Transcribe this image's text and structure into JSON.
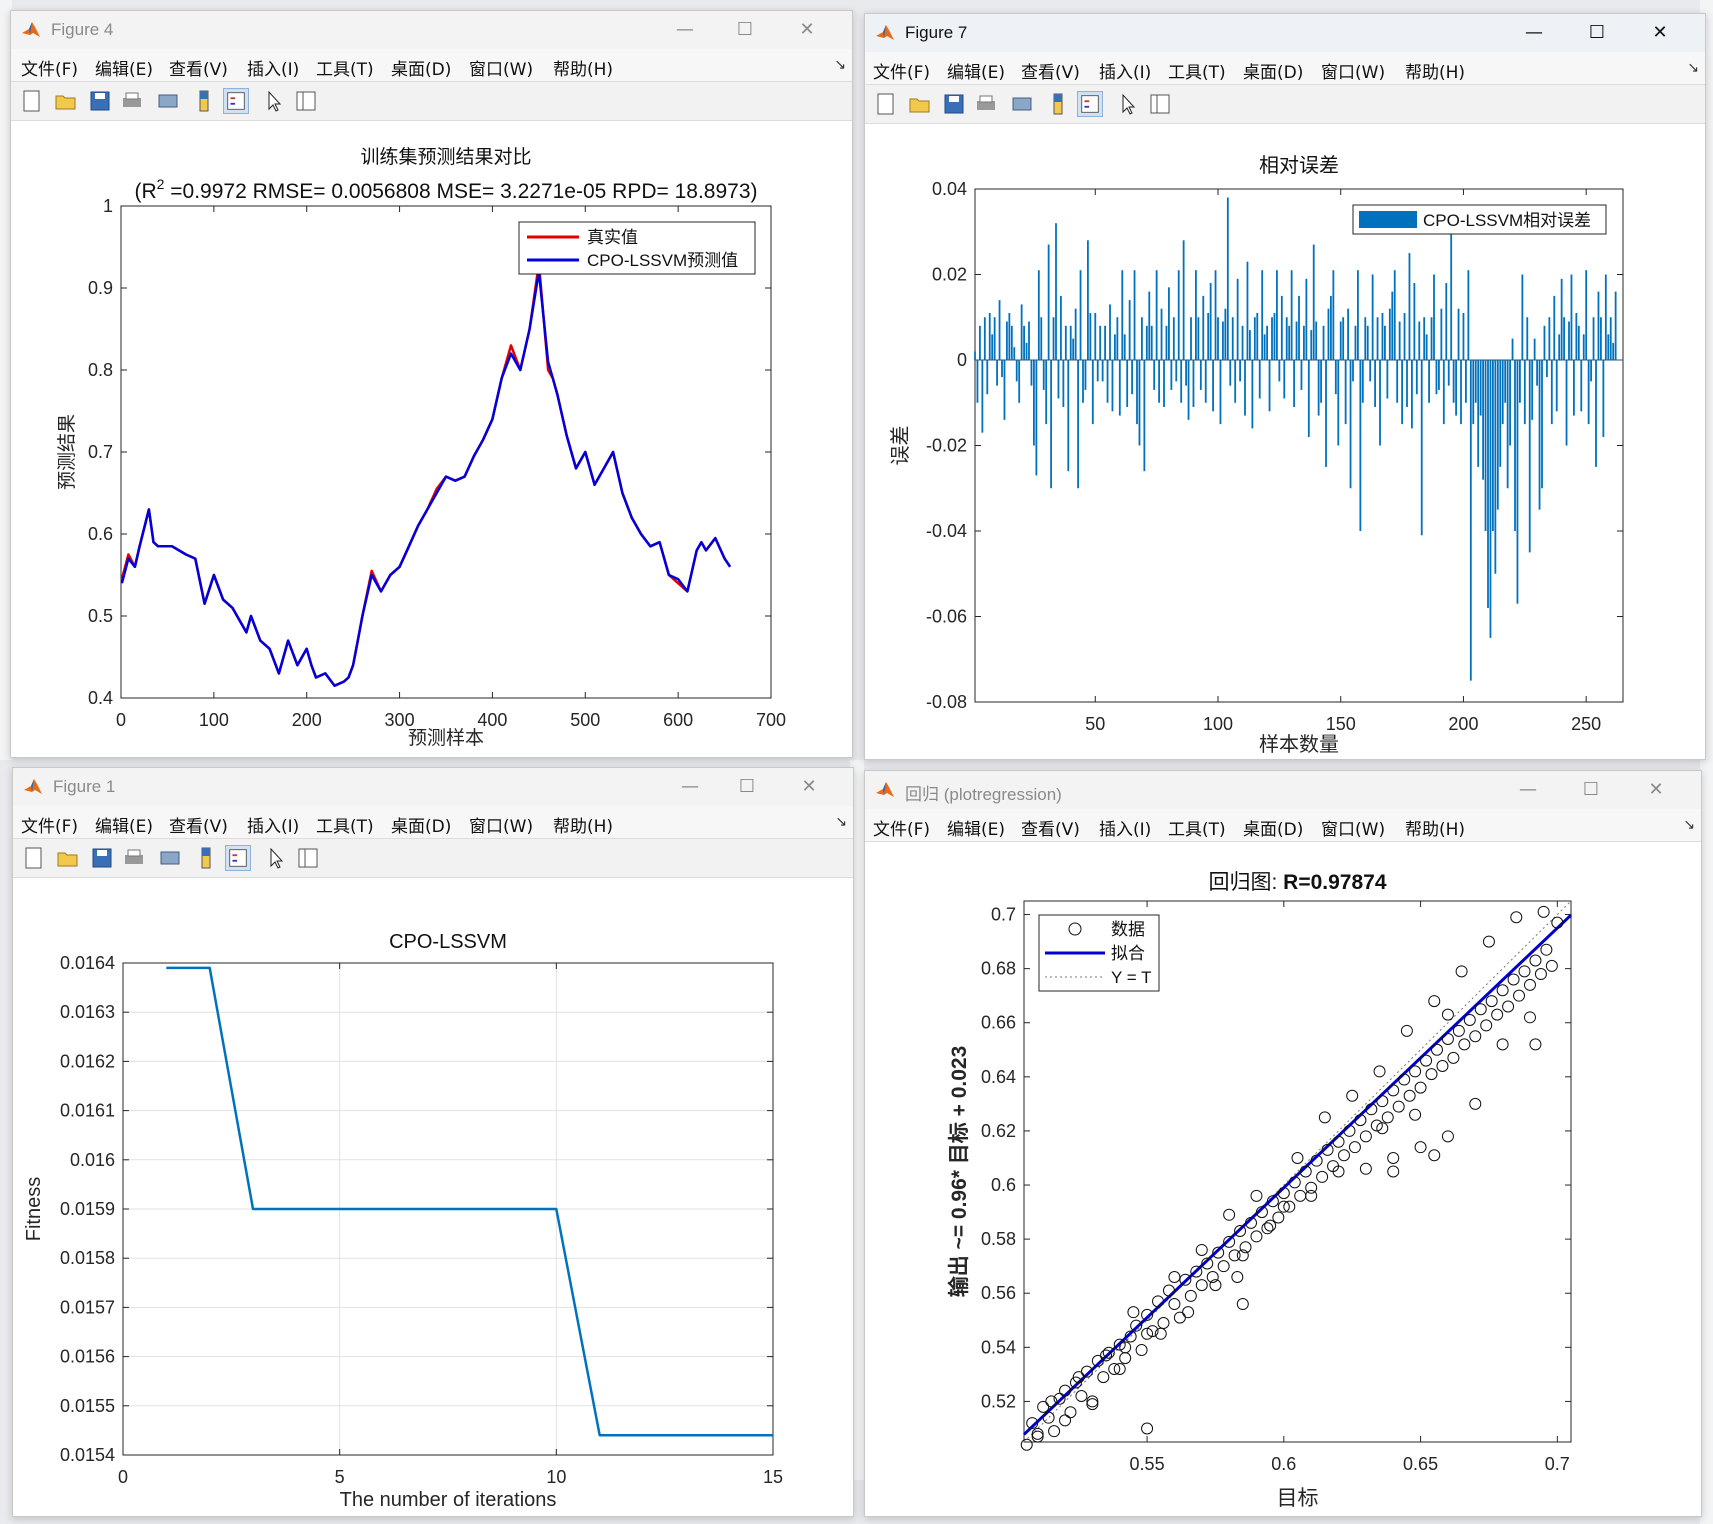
{
  "windows": {
    "fig4": {
      "title": "Figure 4"
    },
    "fig7": {
      "title": "Figure 7"
    },
    "fig1": {
      "title": "Figure 1"
    },
    "reg": {
      "title": "回归 (plotregression)"
    }
  },
  "menu": [
    "文件(F)",
    "编辑(E)",
    "查看(V)",
    "插入(I)",
    "工具(T)",
    "桌面(D)",
    "窗口(W)",
    "帮助(H)"
  ],
  "window_buttons": {
    "minimize": "—",
    "maximize": "☐",
    "close": "✕"
  },
  "toolbar_icons": [
    "new-figure-icon",
    "open-file-icon",
    "save-icon",
    "print-icon",
    "print-preview-icon",
    "colorbar-icon",
    "legend-icon",
    "edit-plot-icon",
    "property-inspector-icon"
  ],
  "colors": {
    "red": "#e00000",
    "blue": "#0000dd",
    "matlab_blue": "#0072bd",
    "dark_blue": "#0000cc"
  },
  "fig4": {
    "chart_data": {
      "type": "line",
      "title": "训练集预测结果对比",
      "subtitle_parts": [
        "(R",
        "2",
        " =0.9972 RMSE= 0.0056808 MSE= 3.2271e-05 RPD= 18.8973)"
      ],
      "xlabel": "预测样本",
      "ylabel": "预测结果",
      "xlim": [
        0,
        700
      ],
      "ylim": [
        0.4,
        1.0
      ],
      "xticks": [
        "0",
        "100",
        "200",
        "300",
        "400",
        "500",
        "600",
        "700"
      ],
      "yticks": [
        "0.4",
        "0.5",
        "0.6",
        "0.7",
        "0.8",
        "0.9",
        "1"
      ],
      "legend": [
        "真实值",
        "CPO-LSSVM预测值"
      ],
      "legend_position": "top-right",
      "series": [
        {
          "name": "真实值",
          "color": "#e00000",
          "x": [
            1,
            8,
            15,
            20,
            30,
            35,
            40,
            55,
            70,
            80,
            90,
            100,
            110,
            120,
            135,
            140,
            150,
            160,
            170,
            175,
            180,
            190,
            200,
            205,
            210,
            220,
            230,
            240,
            245,
            250,
            255,
            260,
            270,
            280,
            290,
            300,
            310,
            320,
            330,
            340,
            350,
            360,
            370,
            380,
            390,
            400,
            410,
            420,
            430,
            440,
            450,
            460,
            465,
            470,
            480,
            490,
            500,
            510,
            520,
            530,
            540,
            550,
            560,
            570,
            580,
            590,
            600,
            610,
            620,
            625,
            630,
            640,
            650,
            656
          ],
          "y": [
            0.545,
            0.575,
            0.56,
            0.585,
            0.63,
            0.59,
            0.585,
            0.585,
            0.575,
            0.57,
            0.515,
            0.55,
            0.52,
            0.51,
            0.48,
            0.5,
            0.47,
            0.46,
            0.43,
            0.45,
            0.47,
            0.44,
            0.46,
            0.44,
            0.425,
            0.43,
            0.415,
            0.42,
            0.425,
            0.44,
            0.47,
            0.5,
            0.555,
            0.53,
            0.55,
            0.56,
            0.585,
            0.61,
            0.63,
            0.655,
            0.67,
            0.665,
            0.67,
            0.695,
            0.715,
            0.74,
            0.79,
            0.83,
            0.8,
            0.85,
            0.93,
            0.8,
            0.79,
            0.77,
            0.72,
            0.68,
            0.7,
            0.66,
            0.68,
            0.7,
            0.65,
            0.62,
            0.6,
            0.585,
            0.59,
            0.55,
            0.54,
            0.53,
            0.58,
            0.59,
            0.58,
            0.595,
            0.57,
            0.56
          ]
        },
        {
          "name": "CPO-LSSVM预测值",
          "color": "#0000dd",
          "x": [
            1,
            8,
            15,
            20,
            30,
            35,
            40,
            55,
            70,
            80,
            90,
            100,
            110,
            120,
            135,
            140,
            150,
            160,
            170,
            175,
            180,
            190,
            200,
            205,
            210,
            220,
            230,
            240,
            245,
            250,
            255,
            260,
            270,
            280,
            290,
            300,
            310,
            320,
            330,
            340,
            350,
            360,
            370,
            380,
            390,
            400,
            410,
            420,
            430,
            440,
            450,
            460,
            465,
            470,
            480,
            490,
            500,
            510,
            520,
            530,
            540,
            550,
            560,
            570,
            580,
            590,
            600,
            610,
            620,
            625,
            630,
            640,
            650,
            656
          ],
          "y": [
            0.54,
            0.57,
            0.56,
            0.585,
            0.63,
            0.59,
            0.585,
            0.585,
            0.575,
            0.57,
            0.515,
            0.55,
            0.52,
            0.51,
            0.48,
            0.5,
            0.47,
            0.46,
            0.43,
            0.45,
            0.47,
            0.44,
            0.46,
            0.44,
            0.425,
            0.43,
            0.415,
            0.42,
            0.425,
            0.44,
            0.47,
            0.5,
            0.55,
            0.53,
            0.55,
            0.56,
            0.585,
            0.61,
            0.63,
            0.65,
            0.67,
            0.665,
            0.67,
            0.695,
            0.715,
            0.74,
            0.79,
            0.82,
            0.8,
            0.85,
            0.92,
            0.81,
            0.79,
            0.77,
            0.72,
            0.68,
            0.7,
            0.66,
            0.68,
            0.7,
            0.65,
            0.62,
            0.6,
            0.585,
            0.59,
            0.55,
            0.545,
            0.53,
            0.58,
            0.59,
            0.58,
            0.595,
            0.57,
            0.56
          ]
        }
      ]
    }
  },
  "fig7": {
    "chart_data": {
      "type": "bar",
      "title": "相对误差",
      "xlabel": "样本数量",
      "ylabel": "误差",
      "xlim": [
        1,
        265
      ],
      "ylim": [
        -0.08,
        0.04
      ],
      "xticks": [
        "50",
        "100",
        "150",
        "200",
        "250"
      ],
      "yticks": [
        "0.04",
        "0.02",
        "0",
        "-0.02",
        "-0.04",
        "-0.06",
        "-0.08"
      ],
      "legend": [
        "CPO-LSSVM相对误差"
      ],
      "legend_position": "top-right",
      "series": [
        {
          "name": "CPO-LSSVM相对误差",
          "color": "#0072bd",
          "values": [
            0.002,
            -0.01,
            0.008,
            -0.017,
            0.01,
            -0.008,
            0.011,
            0.006,
            0.01,
            -0.006,
            0.014,
            -0.004,
            -0.014,
            0.009,
            0.011,
            0.008,
            0.003,
            -0.005,
            -0.01,
            0.013,
            0.008,
            0.004,
            0.009,
            -0.006,
            -0.02,
            -0.027,
            0.021,
            0.01,
            -0.007,
            -0.015,
            0.027,
            -0.03,
            0.01,
            0.032,
            -0.009,
            0.015,
            -0.011,
            0.008,
            -0.026,
            0.008,
            0.005,
            0.012,
            -0.03,
            0.021,
            -0.01,
            -0.007,
            0.028,
            0.011,
            -0.015,
            0.011,
            -0.005,
            0.008,
            -0.005,
            0.008,
            -0.01,
            0.013,
            -0.012,
            0.006,
            0.01,
            -0.013,
            0.021,
            0.006,
            -0.011,
            0.014,
            -0.008,
            0.021,
            -0.015,
            -0.02,
            0.01,
            -0.026,
            0.008,
            0.016,
            0.008,
            -0.007,
            0.021,
            -0.01,
            0.012,
            -0.011,
            0.008,
            0.017,
            -0.007,
            0.01,
            -0.005,
            0.021,
            -0.01,
            0.028,
            -0.006,
            -0.014,
            0.01,
            -0.011,
            0.021,
            0.01,
            -0.007,
            0.015,
            -0.01,
            0.011,
            0.018,
            -0.012,
            0.021,
            0.01,
            -0.015,
            0.009,
            0.012,
            0.038,
            -0.006,
            0.01,
            -0.01,
            0.019,
            -0.005,
            0.008,
            -0.013,
            0.023,
            0.007,
            -0.016,
            0.01,
            0.011,
            -0.009,
            0.021,
            0.006,
            0.008,
            -0.012,
            0.01,
            0.011,
            0.021,
            -0.005,
            0.015,
            -0.009,
            0.01,
            0.008,
            0.021,
            -0.011,
            0.009,
            0.015,
            -0.007,
            0.008,
            0.019,
            -0.018,
            0.007,
            0.027,
            0.009,
            -0.013,
            -0.01,
            0.008,
            -0.025,
            0.012,
            0.015,
            0.021,
            -0.008,
            -0.02,
            0.009,
            0.01,
            -0.015,
            0.012,
            -0.03,
            -0.005,
            0.008,
            0.021,
            -0.04,
            -0.01,
            0.01,
            0.008,
            -0.005,
            0.02,
            -0.011,
            0.01,
            -0.02,
            0.011,
            0.008,
            -0.009,
            0.012,
            0.016,
            0.021,
            -0.01,
            0.009,
            -0.015,
            0.011,
            -0.011,
            0.025,
            -0.016,
            0.018,
            -0.008,
            0.009,
            -0.041,
            0.01,
            0.006,
            -0.01,
            0.01,
            0.02,
            -0.008,
            -0.007,
            0.012,
            -0.015,
            0.018,
            -0.006,
            0.03,
            -0.01,
            -0.013,
            0.012,
            -0.015,
            0.011,
            -0.01,
            0.021,
            -0.075,
            -0.015,
            -0.01,
            -0.025,
            -0.013,
            -0.028,
            -0.04,
            -0.058,
            -0.065,
            -0.04,
            -0.05,
            -0.035,
            -0.025,
            -0.015,
            -0.01,
            -0.03,
            -0.02,
            0.005,
            -0.04,
            -0.057,
            -0.01,
            0.02,
            -0.015,
            0.01,
            -0.045,
            -0.014,
            0.005,
            -0.006,
            -0.035,
            -0.03,
            0.008,
            -0.004,
            0.01,
            -0.015,
            0.015,
            -0.012,
            0.006,
            0.019,
            0.01,
            -0.02,
            0.009,
            0.02,
            -0.013,
            0.011,
            0.008,
            -0.012,
            0.006,
            0.021,
            -0.015,
            -0.005,
            0.01,
            -0.025,
            0.016,
            0.01,
            -0.018,
            0.02,
            0.006,
            0.01,
            0.004,
            0.016
          ]
        }
      ]
    }
  },
  "fig1": {
    "chart_data": {
      "type": "line",
      "title": "CPO-LSSVM",
      "xlabel": "The number of iterations",
      "ylabel": "Fitness",
      "xlim": [
        0,
        15
      ],
      "ylim": [
        0.0154,
        0.0164
      ],
      "grid": true,
      "xticks": [
        "0",
        "5",
        "10",
        "15"
      ],
      "yticks": [
        "0.0164",
        "0.0163",
        "0.0162",
        "0.0161",
        "0.016",
        "0.0159",
        "0.0158",
        "0.0157",
        "0.0156",
        "0.0155",
        "0.0154"
      ],
      "series": [
        {
          "color": "#0072bd",
          "x": [
            1,
            2,
            3,
            4,
            5,
            6,
            7,
            8,
            9,
            10,
            11,
            12,
            13,
            14,
            15
          ],
          "y": [
            0.01639,
            0.01639,
            0.0159,
            0.0159,
            0.0159,
            0.0159,
            0.0159,
            0.0159,
            0.0159,
            0.0159,
            0.01544,
            0.01544,
            0.01544,
            0.01544,
            0.01544
          ]
        }
      ]
    }
  },
  "reg": {
    "chart_data": {
      "type": "scatter",
      "title_prefix": "回归图: ",
      "title_value": "R=0.97874",
      "xlabel": "目标",
      "ylabel": "输出 ~= 0.96* 目标 + 0.023",
      "xlim": [
        0.505,
        0.705
      ],
      "ylim": [
        0.505,
        0.705
      ],
      "xticks": [
        "0.55",
        "0.6",
        "0.65",
        "0.7"
      ],
      "yticks": [
        "0.7",
        "0.68",
        "0.66",
        "0.64",
        "0.62",
        "0.6",
        "0.58",
        "0.56",
        "0.54",
        "0.52"
      ],
      "legend": [
        "数据",
        "拟合",
        "Y = T"
      ],
      "legend_position": "top-left",
      "fit": {
        "slope": 0.96,
        "intercept": 0.023,
        "color": "#0000cc"
      },
      "points_x": [
        0.506,
        0.508,
        0.51,
        0.512,
        0.514,
        0.516,
        0.518,
        0.52,
        0.522,
        0.524,
        0.526,
        0.528,
        0.53,
        0.532,
        0.534,
        0.536,
        0.538,
        0.54,
        0.542,
        0.544,
        0.546,
        0.548,
        0.55,
        0.552,
        0.554,
        0.556,
        0.558,
        0.56,
        0.562,
        0.564,
        0.566,
        0.568,
        0.57,
        0.572,
        0.574,
        0.576,
        0.578,
        0.58,
        0.582,
        0.584,
        0.586,
        0.588,
        0.59,
        0.592,
        0.594,
        0.596,
        0.598,
        0.6,
        0.602,
        0.604,
        0.606,
        0.608,
        0.61,
        0.612,
        0.614,
        0.616,
        0.618,
        0.62,
        0.622,
        0.624,
        0.626,
        0.628,
        0.63,
        0.632,
        0.634,
        0.636,
        0.638,
        0.64,
        0.642,
        0.644,
        0.646,
        0.648,
        0.65,
        0.652,
        0.654,
        0.656,
        0.658,
        0.66,
        0.662,
        0.664,
        0.666,
        0.668,
        0.67,
        0.672,
        0.674,
        0.676,
        0.678,
        0.68,
        0.682,
        0.684,
        0.686,
        0.688,
        0.69,
        0.692,
        0.694,
        0.696,
        0.698,
        0.7,
        0.51,
        0.515,
        0.52,
        0.525,
        0.53,
        0.535,
        0.54,
        0.545,
        0.55,
        0.555,
        0.56,
        0.565,
        0.57,
        0.575,
        0.58,
        0.585,
        0.59,
        0.595,
        0.6,
        0.605,
        0.61,
        0.615,
        0.62,
        0.625,
        0.63,
        0.635,
        0.64,
        0.645,
        0.65,
        0.655,
        0.66,
        0.665,
        0.67,
        0.675,
        0.68,
        0.685,
        0.69,
        0.695,
        0.55,
        0.542,
        0.585,
        0.583,
        0.64,
        0.655,
        0.66,
        0.692,
        0.636,
        0.648
      ],
      "points_y": [
        0.504,
        0.512,
        0.507,
        0.518,
        0.514,
        0.509,
        0.521,
        0.524,
        0.516,
        0.527,
        0.522,
        0.531,
        0.519,
        0.535,
        0.529,
        0.538,
        0.532,
        0.541,
        0.536,
        0.544,
        0.548,
        0.539,
        0.552,
        0.546,
        0.557,
        0.549,
        0.561,
        0.556,
        0.551,
        0.565,
        0.559,
        0.568,
        0.563,
        0.571,
        0.566,
        0.575,
        0.57,
        0.579,
        0.574,
        0.583,
        0.577,
        0.586,
        0.581,
        0.59,
        0.584,
        0.594,
        0.588,
        0.597,
        0.592,
        0.601,
        0.596,
        0.605,
        0.599,
        0.609,
        0.603,
        0.613,
        0.607,
        0.616,
        0.611,
        0.62,
        0.614,
        0.624,
        0.618,
        0.628,
        0.622,
        0.631,
        0.625,
        0.635,
        0.629,
        0.639,
        0.633,
        0.642,
        0.636,
        0.646,
        0.641,
        0.65,
        0.644,
        0.654,
        0.647,
        0.657,
        0.652,
        0.661,
        0.655,
        0.665,
        0.659,
        0.668,
        0.663,
        0.672,
        0.666,
        0.676,
        0.67,
        0.679,
        0.674,
        0.683,
        0.678,
        0.687,
        0.681,
        0.697,
        0.508,
        0.52,
        0.513,
        0.529,
        0.52,
        0.537,
        0.532,
        0.553,
        0.545,
        0.545,
        0.566,
        0.553,
        0.576,
        0.563,
        0.589,
        0.574,
        0.596,
        0.585,
        0.592,
        0.61,
        0.596,
        0.625,
        0.605,
        0.633,
        0.606,
        0.642,
        0.61,
        0.657,
        0.614,
        0.668,
        0.618,
        0.679,
        0.63,
        0.69,
        0.652,
        0.699,
        0.662,
        0.701,
        0.51,
        0.54,
        0.556,
        0.566,
        0.605,
        0.611,
        0.663,
        0.652,
        0.621,
        0.626
      ]
    }
  }
}
